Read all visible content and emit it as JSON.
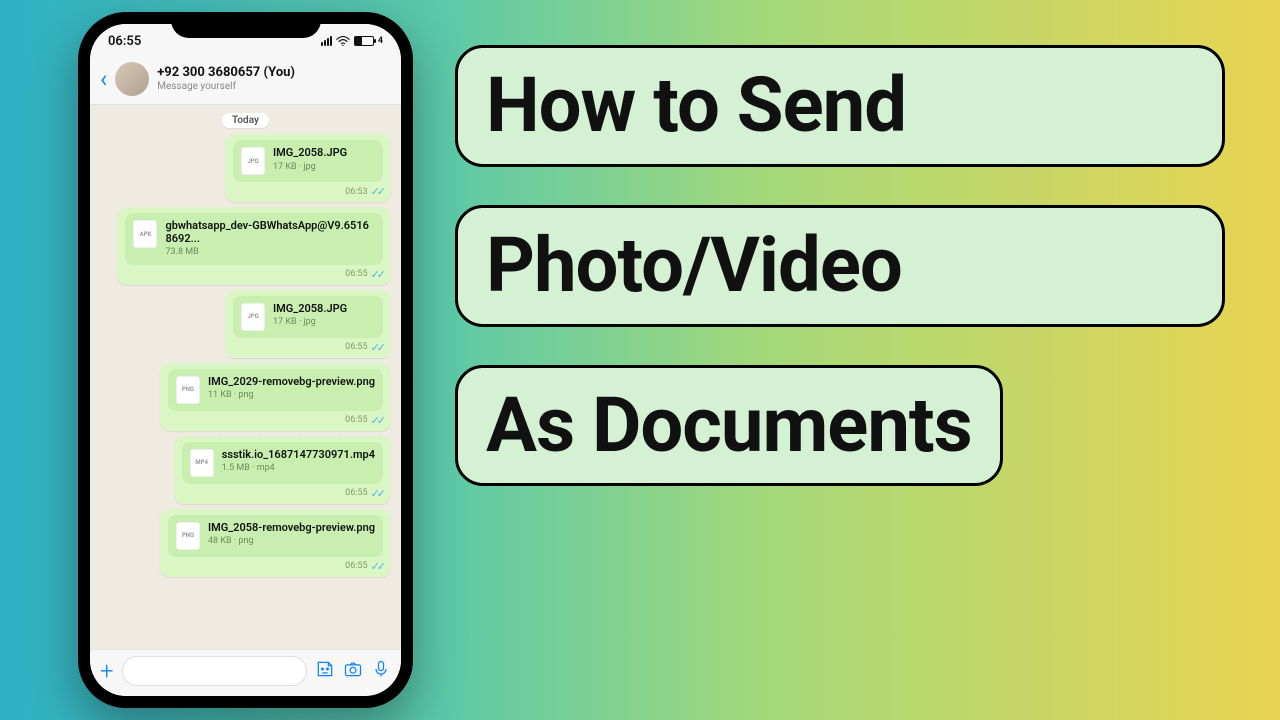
{
  "statusbar": {
    "time": "06:55",
    "battery_label": "4"
  },
  "header": {
    "contact": "+92 300 3680657 (You)",
    "subtitle": "Message yourself"
  },
  "chat": {
    "date_chip": "Today",
    "messages": [
      {
        "ext": "JPG",
        "name": "IMG_2058.JPG",
        "meta": "17 KB · jpg",
        "time": "06:53"
      },
      {
        "ext": "APK",
        "name": "gbwhatsapp_dev-GBWhatsApp@V9.65168692...",
        "meta": "73.8 MB",
        "time": "06:55",
        "wide": true
      },
      {
        "ext": "JPG",
        "name": "IMG_2058.JPG",
        "meta": "17 KB · jpg",
        "time": "06:55"
      },
      {
        "ext": "PNG",
        "name": "IMG_2029-removebg-preview.png",
        "meta": "11 KB · png",
        "time": "06:55"
      },
      {
        "ext": "MP4",
        "name": "ssstik.io_1687147730971.mp4",
        "meta": "1.5 MB · mp4",
        "time": "06:55",
        "wide": true
      },
      {
        "ext": "PNG",
        "name": "IMG_2058-removebg-preview.png",
        "meta": "48 KB · png",
        "time": "06:55"
      }
    ]
  },
  "cards": {
    "line1": "How to Send",
    "line2": "Photo/Video",
    "line3": "As Documents"
  }
}
